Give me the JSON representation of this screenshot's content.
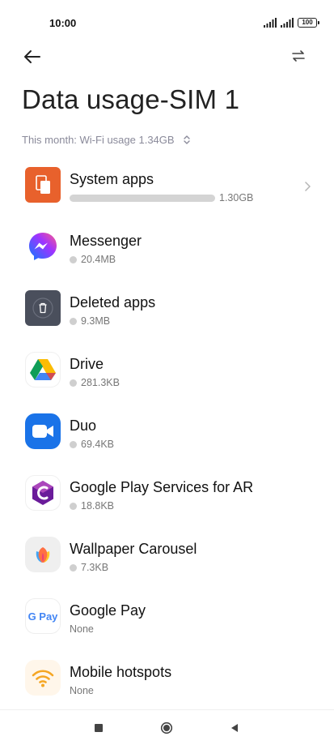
{
  "status_bar": {
    "time": "10:00",
    "battery": "100",
    "icons": [
      "signal-icon",
      "signal-icon",
      "battery-icon"
    ]
  },
  "topbar": {
    "back_icon": "arrow-left-icon",
    "switch_icon": "swap-arrows-icon"
  },
  "page": {
    "title": "Data usage-SIM 1",
    "month_summary": "This month: Wi-Fi usage 1.34GB",
    "month_icon": "up-down-chevron-icon"
  },
  "apps": [
    {
      "name": "System apps",
      "usage": "1.30GB",
      "indicator": "bar",
      "icon": "system-apps-icon",
      "has_chevron": true
    },
    {
      "name": "Messenger",
      "usage": "20.4MB",
      "indicator": "dot",
      "icon": "messenger-icon"
    },
    {
      "name": "Deleted apps",
      "usage": "9.3MB",
      "indicator": "dot",
      "icon": "trash-icon"
    },
    {
      "name": "Drive",
      "usage": "281.3KB",
      "indicator": "dot",
      "icon": "drive-icon"
    },
    {
      "name": "Duo",
      "usage": "69.4KB",
      "indicator": "dot",
      "icon": "duo-icon"
    },
    {
      "name": "Google Play Services for AR",
      "usage": "18.8KB",
      "indicator": "dot",
      "icon": "arcore-icon"
    },
    {
      "name": "Wallpaper Carousel",
      "usage": "7.3KB",
      "indicator": "dot",
      "icon": "wallpaper-carousel-icon"
    },
    {
      "name": "Google Pay",
      "usage": "None",
      "indicator": "none",
      "icon": "google-pay-icon",
      "icon_text": "G Pay"
    },
    {
      "name": "Mobile hotspots",
      "usage": "None",
      "indicator": "none",
      "icon": "hotspot-icon"
    }
  ],
  "nav_bar": {
    "recents_icon": "square-icon",
    "home_icon": "circle-icon",
    "back_icon": "triangle-back-icon"
  },
  "colors": {
    "accent_orange": "#e8612c",
    "deleted_bg": "#4a4f5c",
    "duo_blue": "#1a73e8",
    "hotspot_orange": "#f5a623",
    "muted_text": "#8a8a9a"
  }
}
